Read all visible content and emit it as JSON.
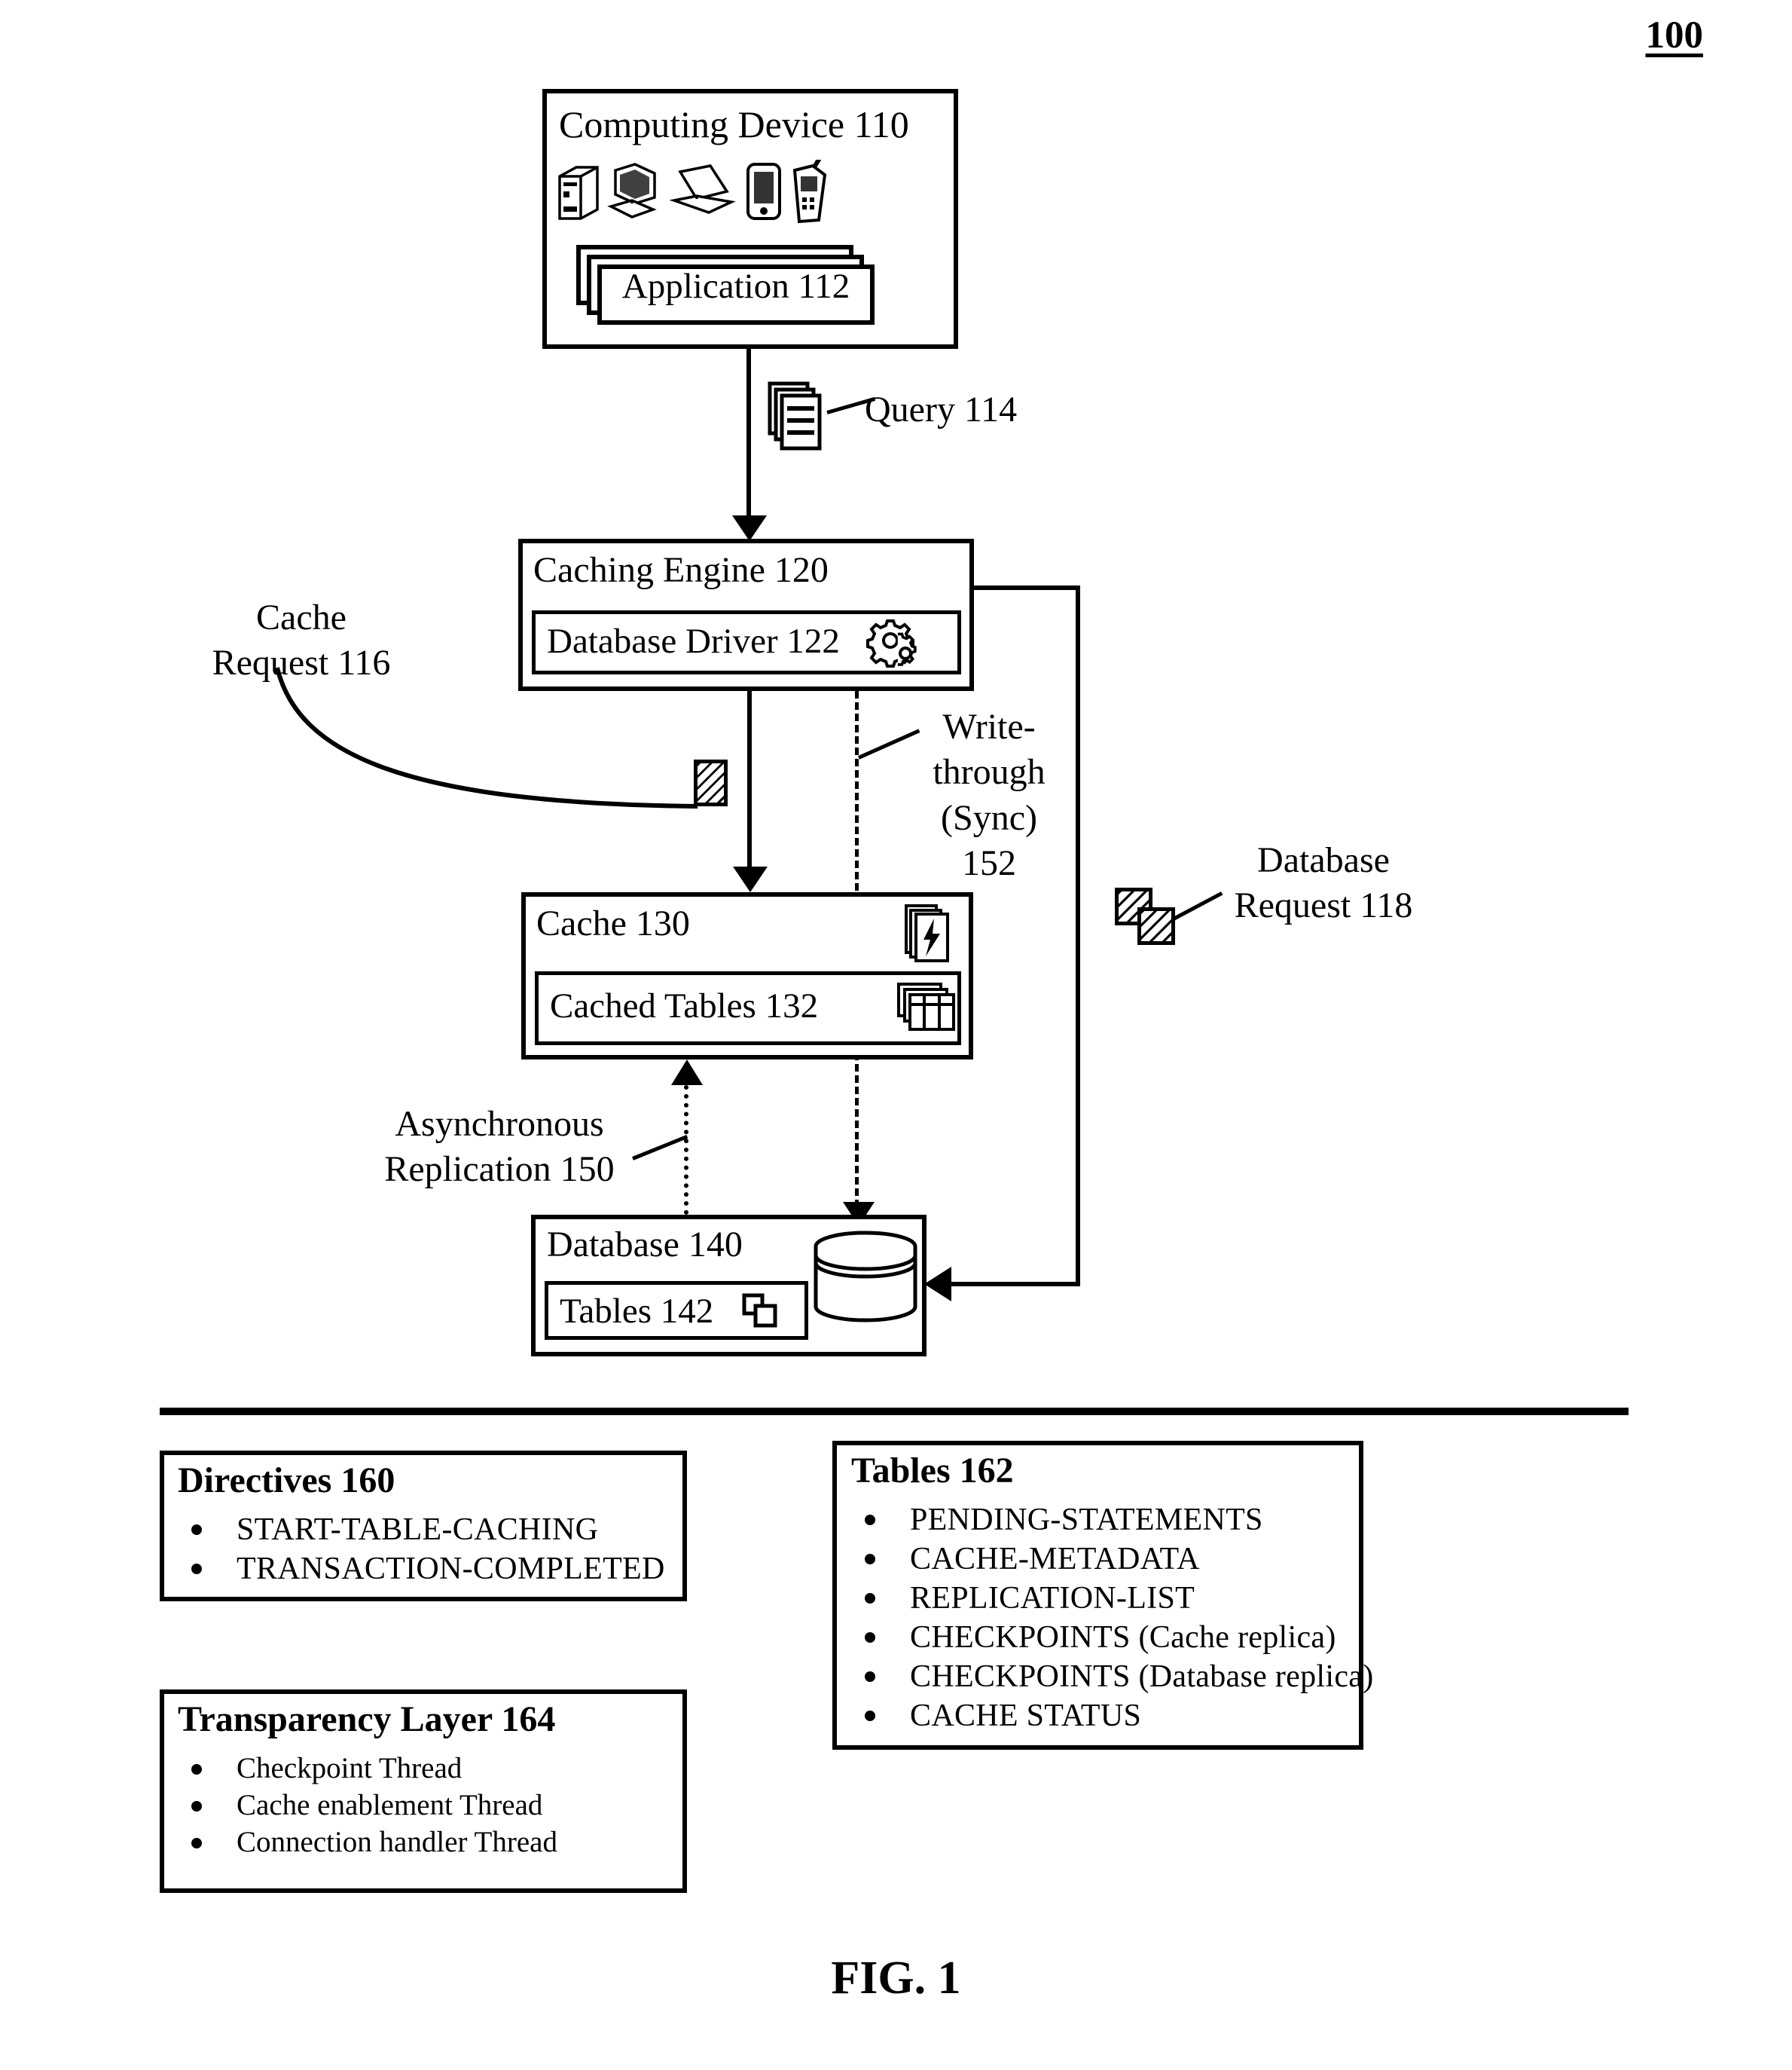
{
  "figure": {
    "number_label": "100",
    "caption": "FIG. 1"
  },
  "computing_device": {
    "title": "Computing Device 110",
    "application_label": "Application 112",
    "device_icons": [
      "desktop-tower-icon",
      "workstation-icon",
      "laptop-icon",
      "pda-icon",
      "mobile-phone-icon"
    ]
  },
  "query": {
    "label": "Query 114",
    "icon": "documents-stack-icon"
  },
  "caching_engine": {
    "title": "Caching Engine 120",
    "driver_label": "Database Driver 122",
    "driver_icon": "gears-icon"
  },
  "cache_request": {
    "label_line1": "Cache",
    "label_line2": "Request 116",
    "swatch_icon": "hatched-square-icon"
  },
  "write_through": {
    "label_line1": "Write-",
    "label_line2": "through",
    "label_line3": "(Sync)",
    "label_line4": "152"
  },
  "cache": {
    "title": "Cache 130",
    "cached_tables_label": "Cached Tables 132",
    "lightning_icon": "lightning-bolt-pages-icon",
    "tables_icon": "table-grid-icon"
  },
  "database_request": {
    "label_line1": "Database",
    "label_line2": "Request 118",
    "swatch_icon": "hatched-square-icon"
  },
  "async_replication": {
    "label_line1": "Asynchronous",
    "label_line2": "Replication 150"
  },
  "database": {
    "title": "Database 140",
    "tables_label": "Tables 142",
    "tables_icon": "copy-tables-icon",
    "cylinder_icon": "database-cylinder-icon"
  },
  "directives": {
    "title": "Directives 160",
    "items": [
      "START-TABLE-CACHING",
      "TRANSACTION-COMPLETED"
    ]
  },
  "transparency_layer": {
    "title": "Transparency Layer 164",
    "items": [
      "Checkpoint Thread",
      "Cache enablement Thread",
      "Connection handler Thread"
    ]
  },
  "tables_panel": {
    "title": "Tables 162",
    "items": [
      "PENDING-STATEMENTS",
      "CACHE-METADATA",
      "REPLICATION-LIST",
      "CHECKPOINTS (Cache replica)",
      "CHECKPOINTS (Database replica)",
      "CACHE STATUS"
    ]
  },
  "colors": {
    "ink": "#000000",
    "paper": "#ffffff"
  }
}
